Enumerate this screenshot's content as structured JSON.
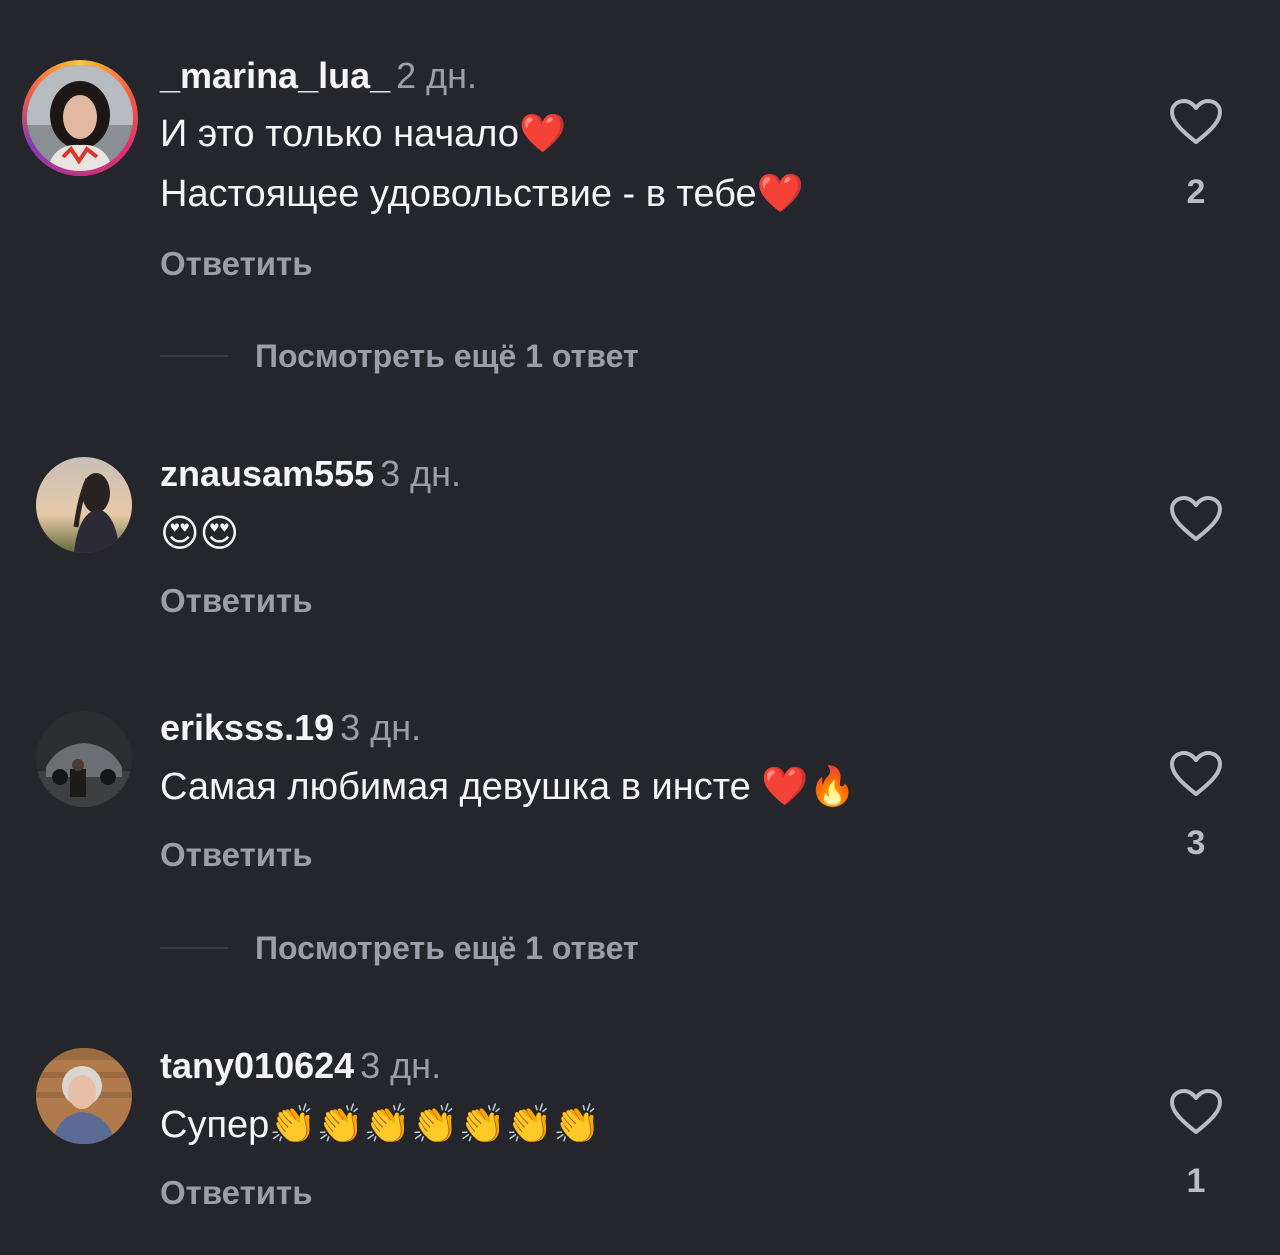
{
  "reply_label": "Ответить",
  "comments": [
    {
      "username": "_marina_lua_",
      "time": "2 дн.",
      "lines": [
        "И это только начало❤️",
        "Настоящее удовольствие - в тебе❤️"
      ],
      "likes": "2",
      "more_replies": "Посмотреть ещё 1 ответ",
      "has_story": true
    },
    {
      "username": "znausam555",
      "time": "3 дн.",
      "lines": [
        "😍😍"
      ],
      "likes": "",
      "more_replies": ""
    },
    {
      "username": "eriksss.19",
      "time": "3 дн.",
      "lines": [
        "Самая любимая девушка в инсте ❤️🔥"
      ],
      "likes": "3",
      "more_replies": "Посмотреть ещё 1 ответ"
    },
    {
      "username": "tany010624",
      "time": "3 дн.",
      "lines": [
        "Супер👏👏👏👏👏👏👏"
      ],
      "likes": "1",
      "more_replies": ""
    }
  ],
  "colors": {
    "background": "#24262c",
    "secondary_text": "#9b9ea6",
    "primary_text": "#f5f5f7"
  },
  "icons": [
    "heart-outline-icon"
  ]
}
